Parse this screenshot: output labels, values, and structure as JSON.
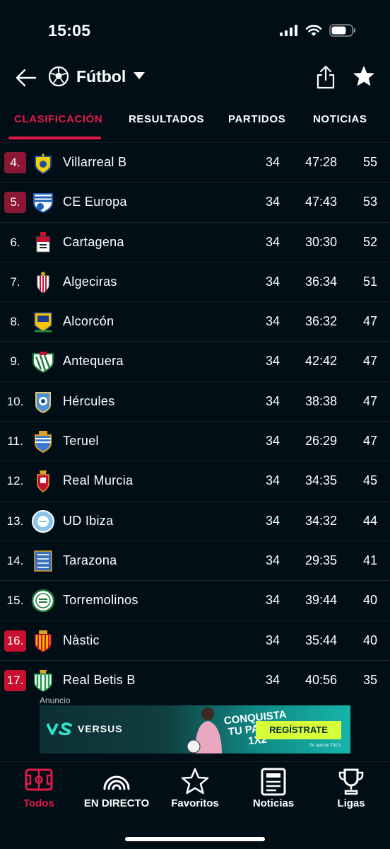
{
  "status_bar": {
    "time": "15:05"
  },
  "header": {
    "sport": "Fútbol"
  },
  "tabs": [
    {
      "label": "CLASIFICACIÓN",
      "active": true
    },
    {
      "label": "RESULTADOS",
      "active": false
    },
    {
      "label": "PARTIDOS",
      "active": false
    },
    {
      "label": "NOTICIAS",
      "active": false
    }
  ],
  "standings": [
    {
      "position": "4.",
      "team": "Villarreal B",
      "played": "34",
      "goals": "47:28",
      "points": "55",
      "zone": "promotion"
    },
    {
      "position": "5.",
      "team": "CE Europa",
      "played": "34",
      "goals": "47:43",
      "points": "53",
      "zone": "promotion"
    },
    {
      "position": "6.",
      "team": "Cartagena",
      "played": "34",
      "goals": "30:30",
      "points": "52",
      "zone": "none"
    },
    {
      "position": "7.",
      "team": "Algeciras",
      "played": "34",
      "goals": "36:34",
      "points": "51",
      "zone": "none"
    },
    {
      "position": "8.",
      "team": "Alcorcón",
      "played": "34",
      "goals": "36:32",
      "points": "47",
      "zone": "none"
    },
    {
      "position": "9.",
      "team": "Antequera",
      "played": "34",
      "goals": "42:42",
      "points": "47",
      "zone": "none"
    },
    {
      "position": "10.",
      "team": "Hércules",
      "played": "34",
      "goals": "38:38",
      "points": "47",
      "zone": "none"
    },
    {
      "position": "11.",
      "team": "Teruel",
      "played": "34",
      "goals": "26:29",
      "points": "47",
      "zone": "none"
    },
    {
      "position": "12.",
      "team": "Real Murcia",
      "played": "34",
      "goals": "34:35",
      "points": "45",
      "zone": "none"
    },
    {
      "position": "13.",
      "team": "UD Ibiza",
      "played": "34",
      "goals": "34:32",
      "points": "44",
      "zone": "none"
    },
    {
      "position": "14.",
      "team": "Tarazona",
      "played": "34",
      "goals": "29:35",
      "points": "41",
      "zone": "none"
    },
    {
      "position": "15.",
      "team": "Torremolinos",
      "played": "34",
      "goals": "39:44",
      "points": "40",
      "zone": "none"
    },
    {
      "position": "16.",
      "team": "Nàstic",
      "played": "34",
      "goals": "35:44",
      "points": "40",
      "zone": "relegation"
    },
    {
      "position": "17.",
      "team": "Real Betis B",
      "played": "34",
      "goals": "40:56",
      "points": "35",
      "zone": "relegation"
    }
  ],
  "ad": {
    "label": "Anuncio",
    "brand": "VERSUS",
    "slogan": "CONQUISTA TU PASIÓN 1X2",
    "cta": "REGÍSTRATE",
    "fine_print": "Se aplican T&Cs"
  },
  "bottom_nav": [
    {
      "label": "Todos",
      "icon": "pitch-icon",
      "active": true
    },
    {
      "label": "EN DIRECTO",
      "icon": "live-broadcast-icon",
      "active": false
    },
    {
      "label": "Favoritos",
      "icon": "star-outline-icon",
      "active": false
    },
    {
      "label": "Noticias",
      "icon": "newspaper-icon",
      "active": false
    },
    {
      "label": "Ligas",
      "icon": "trophy-icon",
      "active": false
    }
  ],
  "colors": {
    "background": "#010e16",
    "accent": "#e3184b",
    "promotion_badge": "#8b1734",
    "relegation_badge": "#c8102e"
  }
}
